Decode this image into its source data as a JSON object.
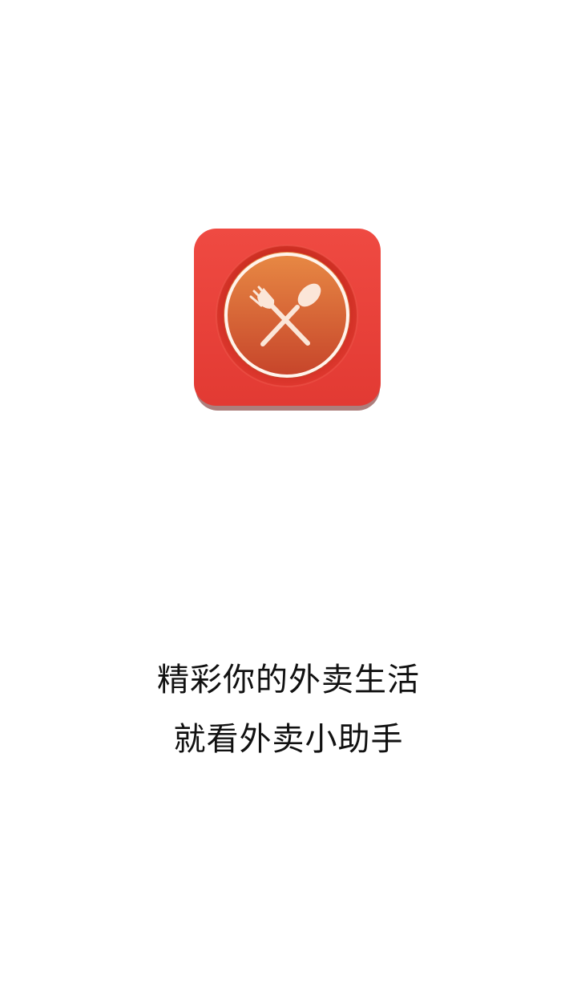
{
  "splash": {
    "logo": {
      "icon": "fork-and-spoon-icon",
      "colors": {
        "tile": "#e8413a",
        "tile_shadow": "#b01e1a",
        "ring": "#c92a1f",
        "plate_top": "#e7873f",
        "plate_bottom": "#c8442a",
        "plate_rim": "#fff4ec",
        "utensils": "#fbe6d8"
      }
    },
    "slogan": {
      "line1": "精彩你的外卖生活",
      "line2": "就看外卖小助手"
    }
  }
}
